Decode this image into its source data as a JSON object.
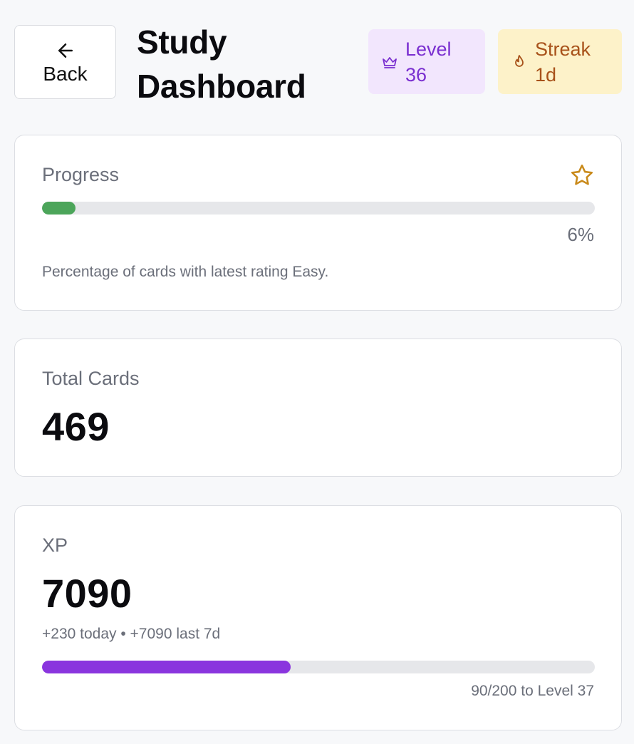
{
  "header": {
    "back_label": "Back",
    "title_line1": "Study",
    "title_line2": "Dashboard",
    "level_badge": {
      "line1": "Level",
      "line2": "36",
      "icon": "crown-icon",
      "color": "#7a2fd0",
      "background": "#f2e6fd"
    },
    "streak_badge": {
      "line1": "Streak",
      "line2": "1d",
      "icon": "flame-icon",
      "color": "#a8521a",
      "background": "#fdf2c9"
    }
  },
  "progress": {
    "label": "Progress",
    "icon": "star-icon",
    "percent": 6,
    "percent_text": "6%",
    "description": "Percentage of cards with latest rating Easy.",
    "bar_color": "#4ca55a"
  },
  "total_cards": {
    "label": "Total Cards",
    "value": "469"
  },
  "xp": {
    "label": "XP",
    "value": "7090",
    "subtitle": "+230 today • +7090 last 7d",
    "level_progress": 0.45,
    "level_progress_text": "90/200 to Level 37",
    "bar_color": "#8a35de"
  }
}
